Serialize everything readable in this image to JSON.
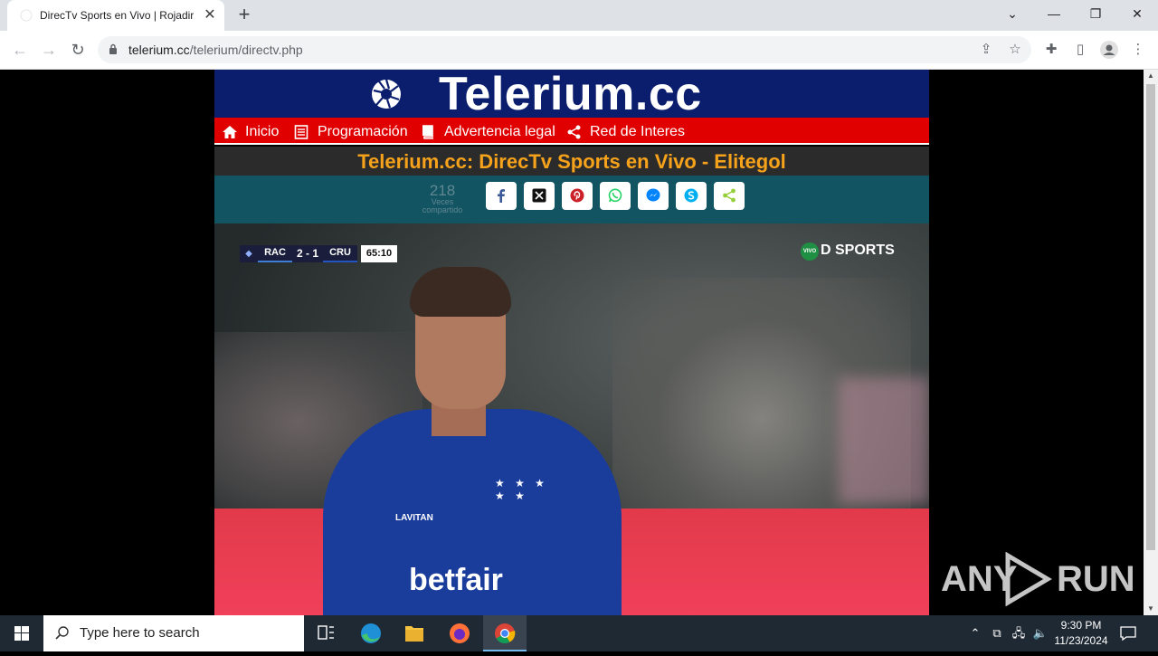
{
  "browser": {
    "tab_title": "DirecTv Sports en Vivo | Rojadirecta",
    "url_domain": "telerium.cc",
    "url_path": "/telerium/directv.php"
  },
  "site": {
    "logo_text": "Telerium.cc",
    "menu": [
      {
        "label": "Inicio",
        "icon": "home-icon"
      },
      {
        "label": "Programación",
        "icon": "list-icon"
      },
      {
        "label": "Advertencia legal",
        "icon": "book-icon"
      },
      {
        "label": "Red de Interes",
        "icon": "share-icon"
      }
    ],
    "page_title": "Telerium.cc: DirecTv Sports en Vivo - Elitegol",
    "share": {
      "count": "218",
      "count_label_1": "Veces",
      "count_label_2": "compartido",
      "buttons": [
        "facebook-icon",
        "x-icon",
        "pinterest-icon",
        "whatsapp-icon",
        "messenger-icon",
        "skype-icon",
        "sharethis-icon"
      ]
    }
  },
  "video": {
    "team_home": "RAC",
    "score": "2 - 1",
    "team_away": "CRU",
    "match_time": "65:10",
    "channel_badge": "VIVO",
    "channel_name": "D SPORTS",
    "sponsor": "betfair",
    "sponsor_small": "LAVITAN"
  },
  "watermark": {
    "left": "ANY",
    "right": "RUN"
  },
  "taskbar": {
    "search_placeholder": "Type here to search",
    "time": "9:30 PM",
    "date": "11/23/2024"
  },
  "colors": {
    "header_bg": "#0b1e6e",
    "menu_bg": "#e00000",
    "title_color": "#f7a21b",
    "share_bg": "#125462"
  }
}
